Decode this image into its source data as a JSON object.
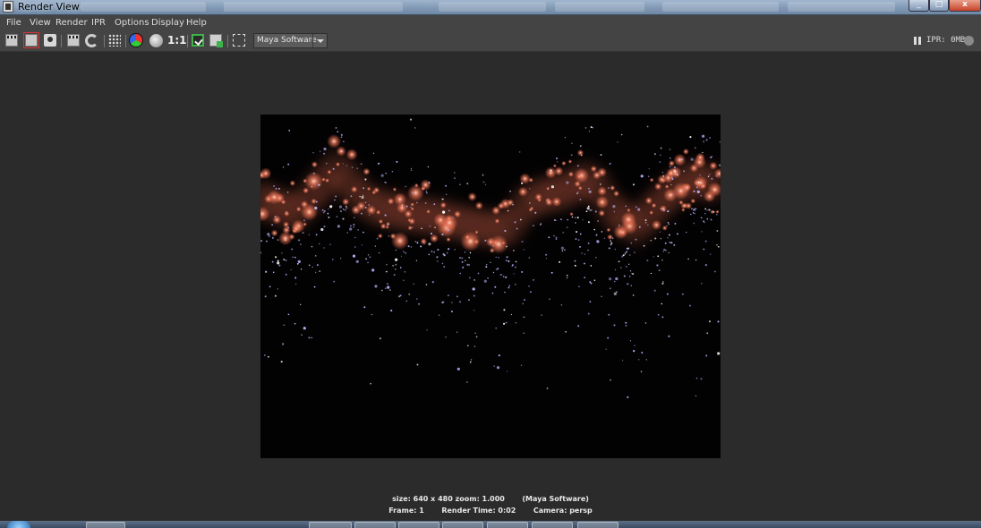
{
  "window": {
    "title": "Render View"
  },
  "menu": [
    "File",
    "View",
    "Render",
    "IPR",
    "Options",
    "Display",
    "Help"
  ],
  "toolbar": {
    "renderer": "Maya Software",
    "ratio_label": "1:1",
    "ipr_status": "IPR: 0MB"
  },
  "render_info": {
    "line1": "size: 640 x 480 zoom: 1.000       (Maya Software)",
    "line2": "Frame: 1       Render Time: 0:02       Camera: persp"
  },
  "colors": {
    "background": "#2b2b2b",
    "nebula_glow": "#e56a4e",
    "stars": "#b9b6ff"
  }
}
